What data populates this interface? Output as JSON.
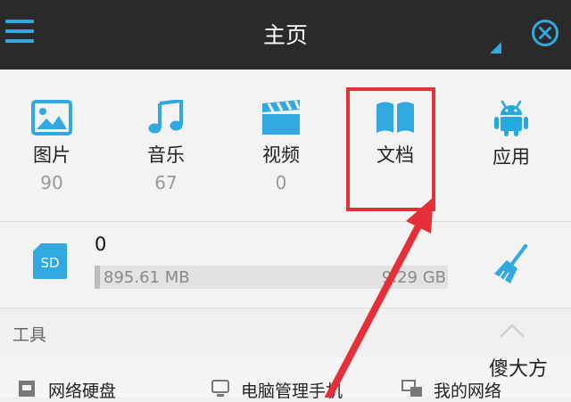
{
  "header": {
    "title": "主页",
    "menu_icon": "hamburger-menu-icon",
    "close_icon": "close-circle-icon"
  },
  "categories": [
    {
      "label": "图片",
      "count": "90",
      "icon": "image-icon"
    },
    {
      "label": "音乐",
      "count": "67",
      "icon": "music-note-icon"
    },
    {
      "label": "视频",
      "count": "0",
      "icon": "clapperboard-icon"
    },
    {
      "label": "文档",
      "count": "",
      "icon": "book-icon"
    },
    {
      "label": "应用",
      "count": "",
      "icon": "android-icon"
    }
  ],
  "storage": {
    "badge": "SD",
    "name": "0",
    "used": "895.61 MB",
    "total": "9.29 GB",
    "clean_icon": "broom-icon"
  },
  "tools": {
    "label": "工具",
    "items": [
      {
        "label": "网络硬盘",
        "icon": "cloud-disk-icon"
      },
      {
        "label": "电脑管理手机",
        "icon": "pc-manage-icon"
      },
      {
        "label": "我的网络",
        "icon": "network-icon"
      }
    ]
  },
  "watermark": "傻大方",
  "colors": {
    "accent": "#31a8e0",
    "header_bg": "#2a2a2a",
    "highlight": "#e5303a",
    "android": "#25a8e0"
  }
}
